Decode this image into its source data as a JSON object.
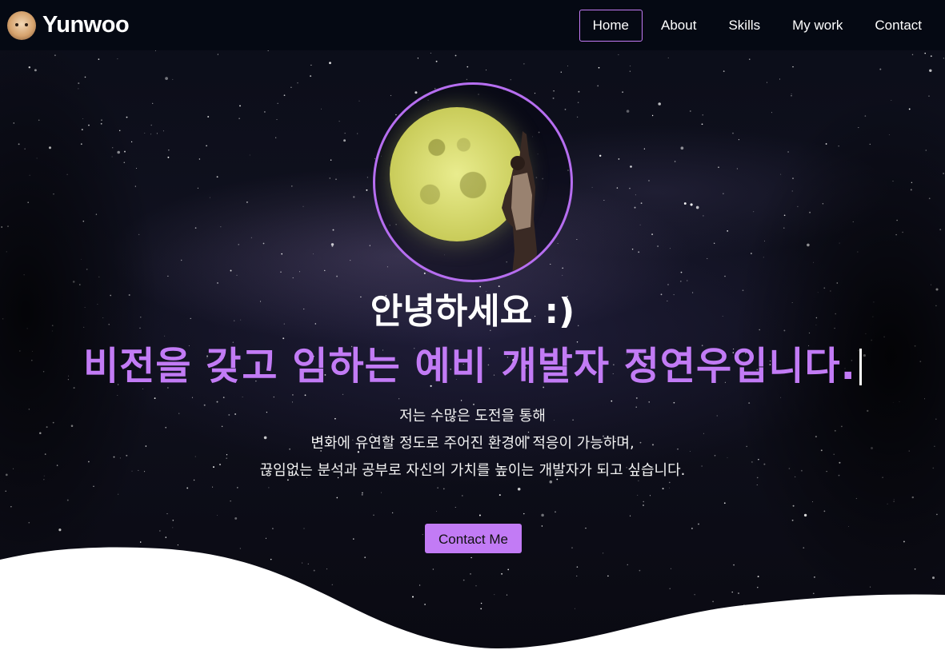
{
  "navbar": {
    "brand": "Yunwoo",
    "links": [
      {
        "label": "Home",
        "active": true
      },
      {
        "label": "About",
        "active": false
      },
      {
        "label": "Skills",
        "active": false
      },
      {
        "label": "My work",
        "active": false
      },
      {
        "label": "Contact",
        "active": false
      }
    ]
  },
  "hero": {
    "greeting": "안녕하세요 :)",
    "tagline": "비전을 갖고 임하는 예비 개발자 정연우입니다.",
    "description": [
      "저는 수많은 도전을 통해",
      "변화에 유연할 정도로 주어진 환경에 적응이 가능하며,",
      "끊임없는 분석과 공부로 자신의 가치를 높이는 개발자가 되고 싶습니다."
    ],
    "button_label": "Contact Me"
  },
  "colors": {
    "accent": "#c27bf5",
    "navbar_bg": "#050913",
    "text": "#ffffff"
  }
}
